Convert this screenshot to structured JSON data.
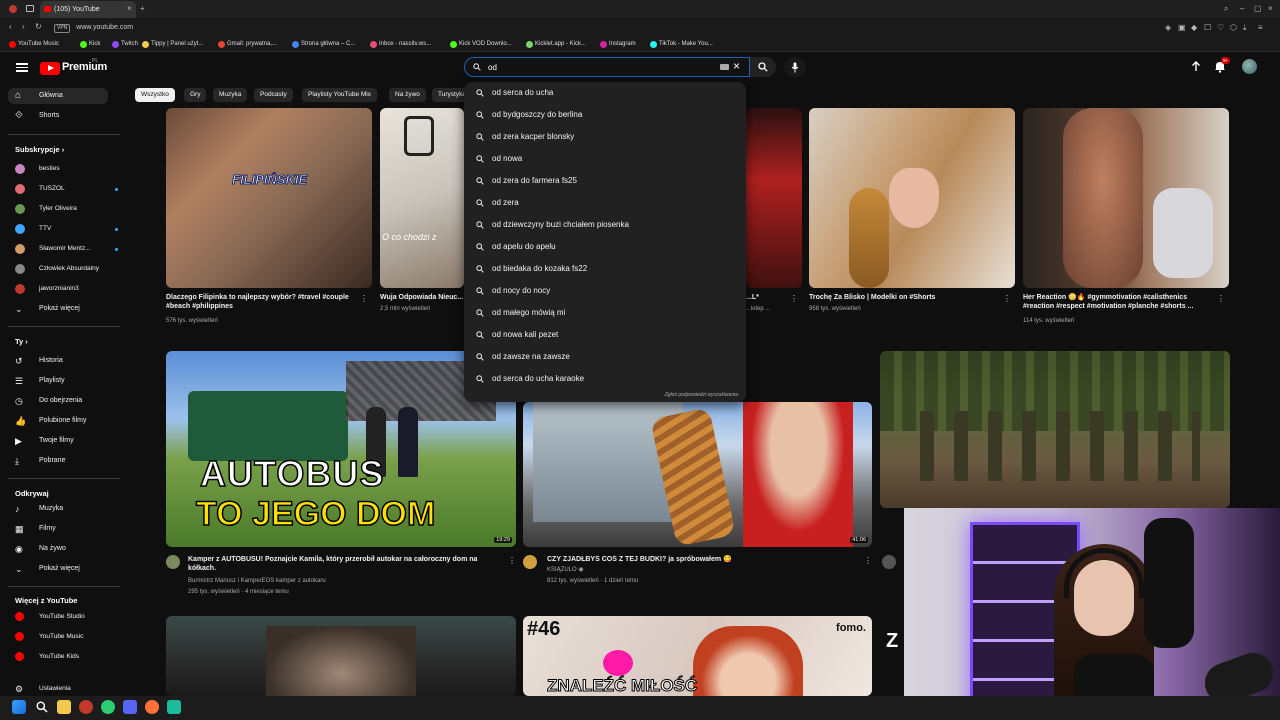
{
  "browser": {
    "tab_title": "(105) YouTube",
    "url": "www.youtube.com",
    "bookmarks": [
      {
        "label": "YouTube Music",
        "color": "#ff0000"
      },
      {
        "label": "Kick",
        "color": "#53fc18"
      },
      {
        "label": "Twitch",
        "color": "#9146ff"
      },
      {
        "label": "Tippy | Panel użyt...",
        "color": "#f2c94c"
      },
      {
        "label": "Gmail: prywatna,...",
        "color": "#ea4335"
      },
      {
        "label": "Strona główna – C...",
        "color": "#4285f4"
      },
      {
        "label": "Inbox - nassitv.ws...",
        "color": "#e94e77"
      },
      {
        "label": "Kick VOD Downlo...",
        "color": "#53fc18"
      },
      {
        "label": "Kicklet.app - Kick...",
        "color": "#7bd36b"
      },
      {
        "label": "Instagram",
        "color": "#d6249f"
      },
      {
        "label": "TikTok - Make You...",
        "color": "#25f4ee"
      }
    ]
  },
  "header": {
    "logo_text": "Premium",
    "logo_region": "PL",
    "search": {
      "value": "od",
      "placeholder": "Szukaj"
    }
  },
  "suggestions": {
    "items": [
      "od serca do ucha",
      "od bydgoszczy do berlina",
      "od zera kacper blonsky",
      "od nowa",
      "od zera do farmera fs25",
      "od zera",
      "od dziewczyny buzi chciałem piosenka",
      "od apelu do apelu",
      "od biedaka do kozaka fs22",
      "od nocy do nocy",
      "od małego mówią mi",
      "od nowa kali pezet",
      "od zawsze na zawsze",
      "od serca do ucha karaoke"
    ],
    "report": "Zgłoś podpowiedzi wyszukiwania"
  },
  "sidebar": {
    "main": [
      {
        "label": "Główna"
      },
      {
        "label": "Shorts"
      }
    ],
    "subs_heading": "Subskrypcje",
    "subs": [
      {
        "label": "besties",
        "color": "#c586c0",
        "live": false
      },
      {
        "label": "TUSZOL",
        "color": "#e06c75",
        "live": true
      },
      {
        "label": "Tyler Oliveira",
        "color": "#6a9955",
        "live": false
      },
      {
        "label": "TTV",
        "color": "#3ea6ff",
        "live": true
      },
      {
        "label": "Sławomir Mentz...",
        "color": "#d19a66",
        "live": true
      },
      {
        "label": "Człowiek Absurdalny",
        "color": "#888888",
        "live": false
      },
      {
        "label": "jaworznianin3",
        "color": "#c0392b",
        "live": false
      }
    ],
    "subs_more": "Pokaż więcej",
    "you_heading": "Ty",
    "you": [
      {
        "label": "Historia"
      },
      {
        "label": "Playlisty"
      },
      {
        "label": "Do obejrzenia"
      },
      {
        "label": "Polubione filmy"
      },
      {
        "label": "Twoje filmy"
      },
      {
        "label": "Pobrane"
      }
    ],
    "explore_heading": "Odkrywaj",
    "explore": [
      {
        "label": "Muzyka"
      },
      {
        "label": "Filmy"
      },
      {
        "label": "Na żywo"
      },
      {
        "label": "Pokaż więcej"
      }
    ],
    "more_heading": "Więcej z YouTube",
    "more": [
      {
        "label": "YouTube Studio"
      },
      {
        "label": "YouTube Music"
      },
      {
        "label": "YouTube Kids"
      }
    ],
    "settings": "Ustawienia"
  },
  "chips": [
    "Wszystko",
    "Gry",
    "Muzyka",
    "Podcasty",
    "Playlisty YouTube Mix",
    "Na żywo",
    "Turystyka"
  ],
  "videos_row1": [
    {
      "title": "Dlaczego Filipinka to najlepszy wybór? #travel #couple #beach #philippines",
      "meta": "576 tys. wyświetleń",
      "overlay": "FILIPIŃSKIE"
    },
    {
      "title": "Wuja Odpowiada Nieuc...",
      "meta": "2,5 mln wyświetleń",
      "overlay": "O co chodzi z"
    },
    {
      "title": "...L*",
      "meta": "...kitep ...",
      "overlay": ""
    },
    {
      "title": "Trochę Za Blisko | Modelki on #Shorts",
      "meta": "958 tys. wyświetleń",
      "overlay": ""
    },
    {
      "title": "Her Reaction 😳🔥 #gymmotivation #calisthenics #reaction #respect #motivation #planche #shorts ...",
      "meta": "114 tys. wyświetleń",
      "overlay": ""
    }
  ],
  "videos_row2": [
    {
      "title": "Kamper z AUTOBUSU! Poznajcie Kamila, który przerobił autokar na całoroczny dom na kółkach.",
      "channel": "Burmistrz Mariusz i KamperEOS kamper z autokaru",
      "meta": "295 tys. wyświetleń · 4 miesiące temu",
      "duration": "19:29",
      "overlay_line1": "AUTOBUS",
      "overlay_line2": "TO JEGO DOM"
    },
    {
      "title": "CZY ZJADŁBYŚ COŚ Z TEJ BUDKI? ja spróbowałem 😋",
      "channel": "KSIĄŻULO ◉",
      "meta": "812 tys. wyświetleń · 1 dzień temu",
      "duration": "41:06"
    },
    {
      "title": "",
      "channel": "",
      "meta": "",
      "duration": ""
    }
  ],
  "videos_row3": [
    {
      "overlay": ""
    },
    {
      "overlay": "#46",
      "overlay2": "ZNALEŹĆ MIŁOŚĆ",
      "badge": "fomo."
    },
    {
      "overlay": "Z"
    }
  ]
}
